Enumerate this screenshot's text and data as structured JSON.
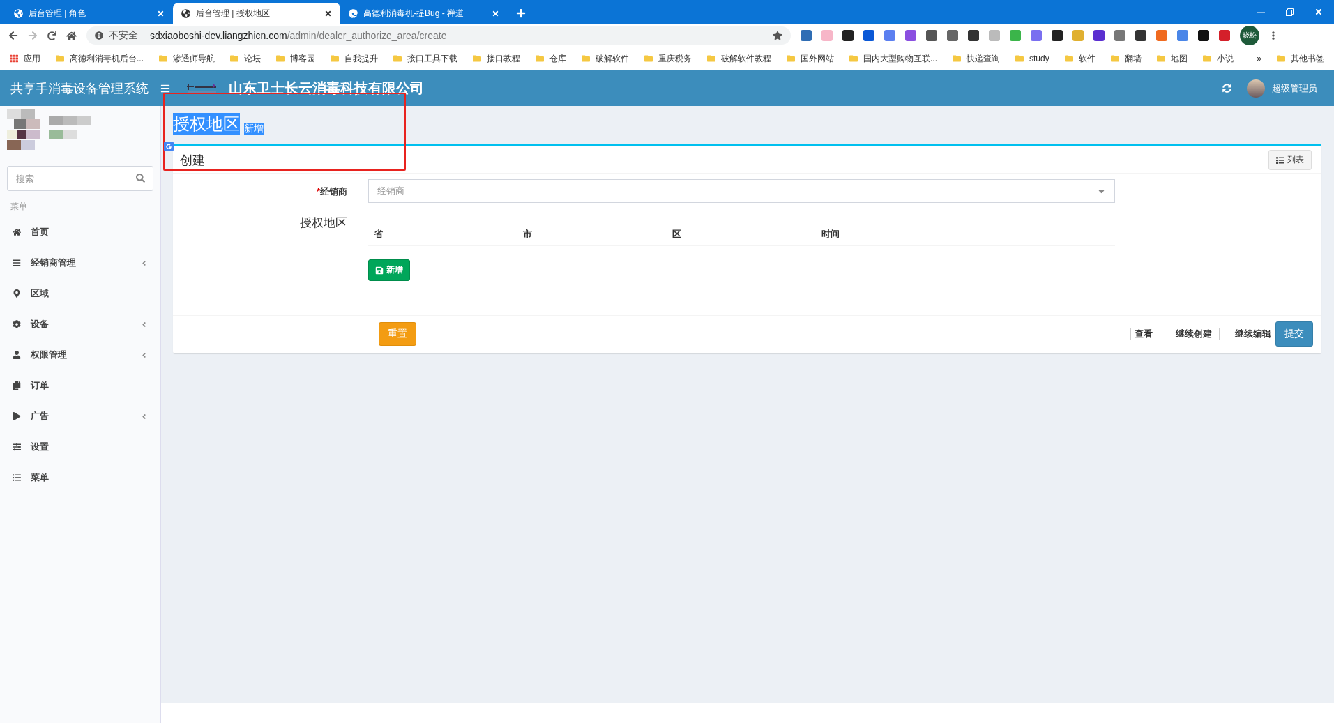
{
  "browser": {
    "tabs": [
      {
        "title": "后台管理 | 角色",
        "selected": false,
        "kind": "globe"
      },
      {
        "title": "后台管理 | 授权地区",
        "selected": true,
        "kind": "globe"
      },
      {
        "title": "高德利消毒机-提Bug - 禅道",
        "selected": false,
        "kind": "edge"
      }
    ],
    "security": "不安全",
    "url_host": "sdxiaoboshi-dev.liangzhicn.com",
    "url_path": "/admin/dealer_authorize_area/create",
    "profile": "晓松",
    "bookmarks": [
      {
        "label": "应用",
        "kind": "apps"
      },
      {
        "label": "高德利消毒机后台...",
        "kind": "folder"
      },
      {
        "label": "渗透师导航",
        "kind": "folder"
      },
      {
        "label": "论坛",
        "kind": "folder"
      },
      {
        "label": "博客园",
        "kind": "folder"
      },
      {
        "label": "自我提升",
        "kind": "folder"
      },
      {
        "label": "接口工具下载",
        "kind": "folder"
      },
      {
        "label": "接口教程",
        "kind": "folder"
      },
      {
        "label": "仓库",
        "kind": "folder"
      },
      {
        "label": "破解软件",
        "kind": "folder"
      },
      {
        "label": "重庆税务",
        "kind": "folder"
      },
      {
        "label": "破解软件教程",
        "kind": "folder"
      },
      {
        "label": "国外网站",
        "kind": "folder"
      },
      {
        "label": "国内大型购物互联...",
        "kind": "folder"
      },
      {
        "label": "快递查询",
        "kind": "folder"
      },
      {
        "label": "study",
        "kind": "folder"
      },
      {
        "label": "软件",
        "kind": "folder"
      },
      {
        "label": "翻墙",
        "kind": "folder"
      },
      {
        "label": "地图",
        "kind": "folder"
      },
      {
        "label": "小说",
        "kind": "folder"
      }
    ],
    "more_bookmarks": "»",
    "other_bookmarks": "其他书签"
  },
  "app": {
    "title": "共享手消毒设备管理系统",
    "company": "山东卫士长云消毒科技有限公司",
    "user": "超级管理员"
  },
  "sidebar": {
    "search_placeholder": "搜索",
    "section": "菜单",
    "items": [
      {
        "label": "首页",
        "kind": "home",
        "has_submenu": false
      },
      {
        "label": "经销商管理",
        "kind": "dealers",
        "has_submenu": true
      },
      {
        "label": "区域",
        "kind": "area",
        "has_submenu": false
      },
      {
        "label": "设备",
        "kind": "device",
        "has_submenu": true
      },
      {
        "label": "权限管理",
        "kind": "permission",
        "has_submenu": true
      },
      {
        "label": "订单",
        "kind": "order",
        "has_submenu": false
      },
      {
        "label": "广告",
        "kind": "ad",
        "has_submenu": true
      },
      {
        "label": "设置",
        "kind": "settings",
        "has_submenu": false
      },
      {
        "label": "菜单",
        "kind": "menu",
        "has_submenu": false
      }
    ]
  },
  "page": {
    "title": "授权地区",
    "subtitle": "新增",
    "box_title": "创建",
    "list_button": "列表",
    "dealer": {
      "label": "经销商",
      "required_mark": "*",
      "placeholder": "经销商"
    },
    "areas": {
      "label": "授权地区",
      "columns": [
        "省",
        "市",
        "区",
        "时间"
      ],
      "add_button": "新增"
    },
    "reset_button": "重置",
    "options": [
      {
        "label": "查看",
        "checked": false
      },
      {
        "label": "继续创建",
        "checked": false
      },
      {
        "label": "继续编辑",
        "checked": false
      }
    ],
    "submit_button": "提交"
  }
}
